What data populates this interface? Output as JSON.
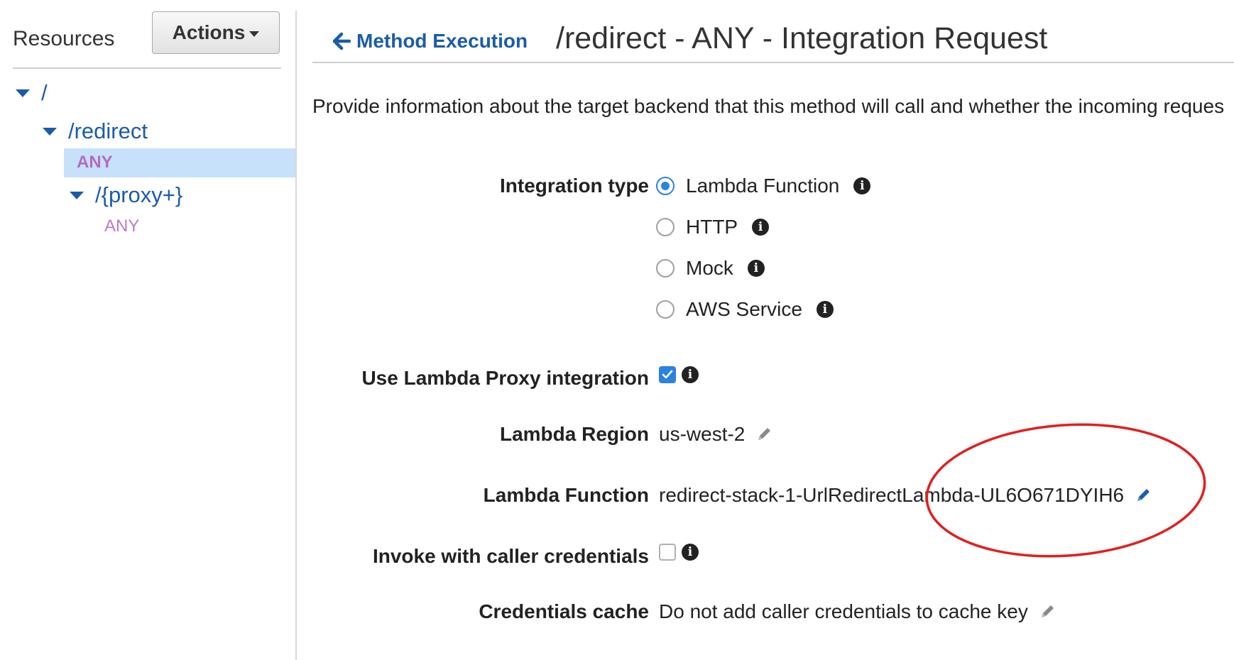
{
  "sidebar": {
    "title": "Resources",
    "actions_label": "Actions",
    "tree": {
      "root": "/",
      "redirect": "/redirect",
      "redirect_method": "ANY",
      "proxy": "/{proxy+}",
      "proxy_method": "ANY"
    }
  },
  "header": {
    "back_label": "Method Execution",
    "title": "/redirect - ANY - Integration Request"
  },
  "description": "Provide information about the target backend that this method will call and whether the incoming reques",
  "form": {
    "integration_type_label": "Integration type",
    "integration_options": [
      "Lambda Function",
      "HTTP",
      "Mock",
      "AWS Service"
    ],
    "integration_selected": "Lambda Function",
    "proxy_label": "Use Lambda Proxy integration",
    "proxy_checked": true,
    "region_label": "Lambda Region",
    "region_value": "us-west-2",
    "function_label": "Lambda Function",
    "function_value": "redirect-stack-1-UrlRedirectLambda-UL6O671DYIH6",
    "invoke_label": "Invoke with caller credentials",
    "invoke_checked": false,
    "cache_label": "Credentials cache",
    "cache_value": "Do not add caller credentials to cache key"
  },
  "colors": {
    "link_blue": "#1a5ca8",
    "method_purple": "#b26bc4",
    "selected_row": "#c8e1fb",
    "radio_blue": "#2a83e0",
    "annotation_red": "#e02020"
  }
}
